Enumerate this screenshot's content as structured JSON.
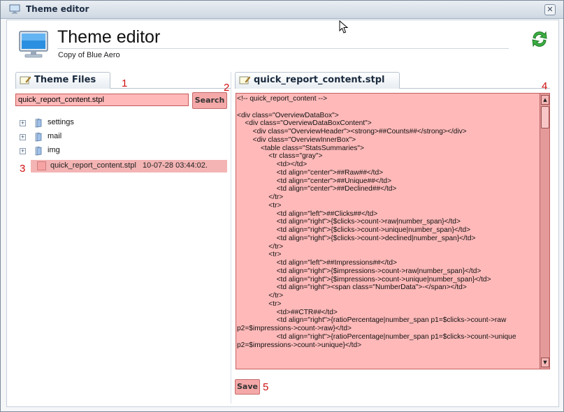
{
  "window": {
    "title": "Theme editor",
    "close_icon": "close-icon",
    "app_icon": "monitor-icon"
  },
  "header": {
    "title": "Theme editor",
    "subtitle": "Copy of Blue Aero",
    "refresh_icon": "refresh-icon",
    "monitor_icon": "monitor-icon"
  },
  "left_panel": {
    "tab_label": "Theme Files",
    "search_value": "quick_report_content.stpl",
    "search_label": "Search",
    "tree": [
      {
        "label": "settings"
      },
      {
        "label": "mail"
      },
      {
        "label": "img"
      }
    ],
    "selected_file": {
      "name": "quick_report_content.stpl",
      "date": "10-07-28 03:44:02."
    }
  },
  "right_panel": {
    "tab_label": "quick_report_content.stpl",
    "code": "<!-- quick_report_content -->\n\n<div class=\"OverviewDataBox\">\n    <div class=\"OverviewDataBoxContent\">\n        <div class=\"OverviewHeader\"><strong>##Counts##</strong></div>\n        <div class=\"OverviewInnerBox\">\n            <table class=\"StatsSummaries\">\n                <tr class=\"gray\">\n                    <td></td>\n                    <td align=\"center\">##Raw##</td>\n                    <td align=\"center\">##Unique##</td>\n                    <td align=\"center\">##Declined##</td>\n                </tr>\n                <tr>\n                    <td align=\"left\">##Clicks##</td>\n                    <td align=\"right\">{$clicks->count->raw|number_span}</td>\n                    <td align=\"right\">{$clicks->count->unique|number_span}</td>\n                    <td align=\"right\">{$clicks->count->declined|number_span}</td>\n                </tr>\n                <tr>\n                    <td align=\"left\">##Impressions##</td>\n                    <td align=\"right\">{$impressions->count->raw|number_span}</td>\n                    <td align=\"right\">{$impressions->count->unique|number_span}</td>\n                    <td align=\"right\"><span class=\"NumberData\">-</span></td>\n                </tr>\n                <tr>\n                    <td>##CTR##</td>\n                    <td align=\"right\">{ratioPercentage|number_span p1=$clicks->count->raw p2=$impressions->count->raw}</td>\n                    <td align=\"right\">{ratioPercentage|number_span p1=$clicks->count->unique p2=$impressions->count->unique}</td>",
    "save_label": "Save"
  },
  "markers": [
    "1",
    "2",
    "3",
    "4",
    "5"
  ],
  "colors": {
    "highlight_fill": "#ffb9b9",
    "highlight_border": "#c46060",
    "marker": "#d01010"
  }
}
